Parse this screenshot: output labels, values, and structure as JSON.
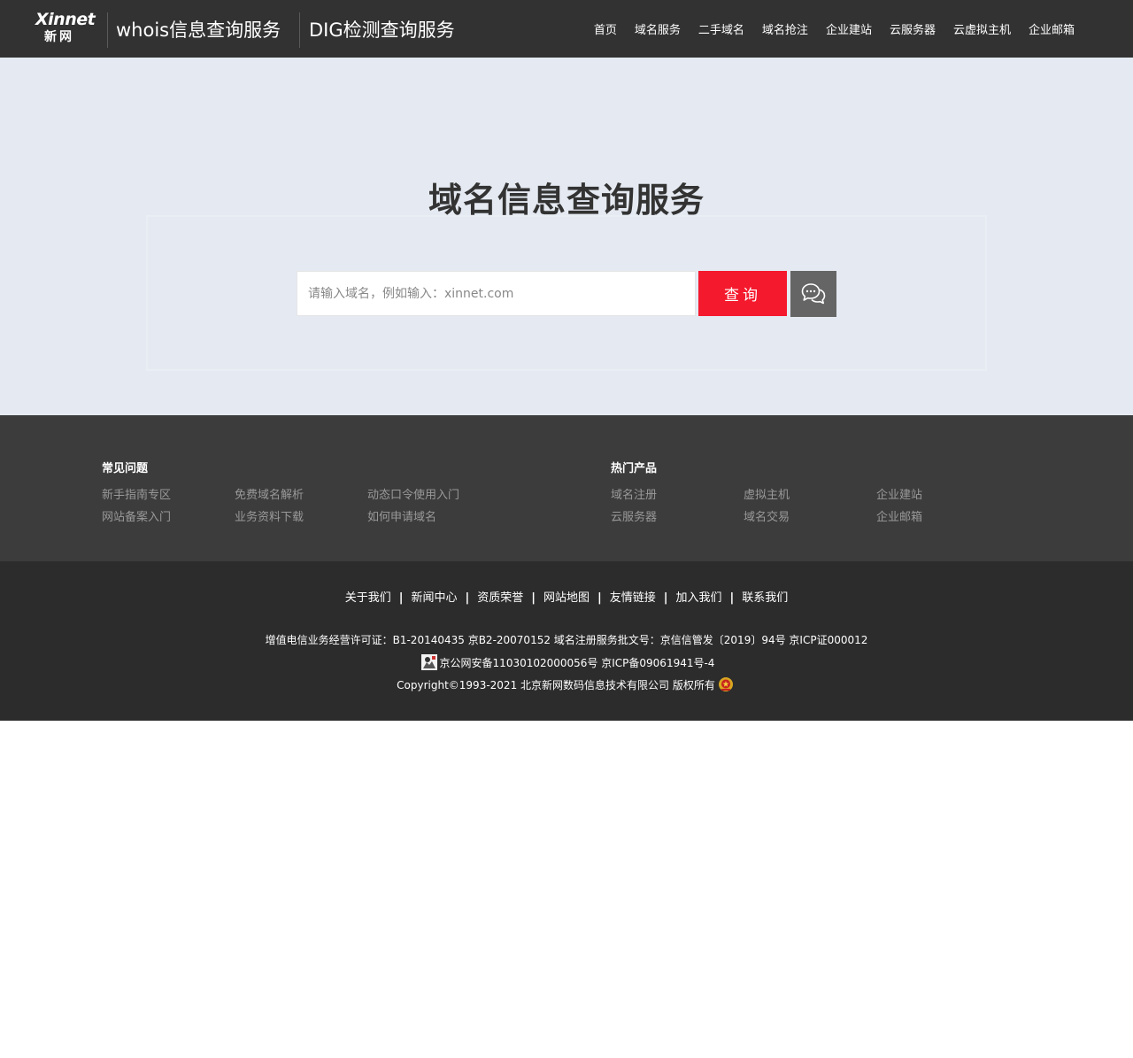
{
  "header": {
    "logo": {
      "line1": "Xinnet",
      "line2": "新网"
    },
    "service_links": [
      "whois信息查询服务",
      "DIG检测查询服务"
    ],
    "nav": [
      "首页",
      "域名服务",
      "二手域名",
      "域名抢注",
      "企业建站",
      "云服务器",
      "云虚拟主机",
      "企业邮箱"
    ]
  },
  "hero": {
    "title": "域名信息查询服务",
    "search": {
      "placeholder": "请输入域名，例如输入：xinnet.com",
      "value": "",
      "button_label": "查询"
    }
  },
  "links": {
    "faq": {
      "title": "常见问题",
      "items": [
        "新手指南专区",
        "免费域名解析",
        "动态口令使用入门",
        "网站备案入门",
        "业务资料下载",
        "如何申请域名"
      ]
    },
    "hot": {
      "title": "热门产品",
      "items": [
        "域名注册",
        "虚拟主机",
        "企业建站",
        "云服务器",
        "域名交易",
        "企业邮箱"
      ]
    }
  },
  "footer": {
    "nav": [
      "关于我们",
      "新闻中心",
      "资质荣誉",
      "网站地图",
      "友情链接",
      "加入我们",
      "联系我们"
    ],
    "license_line": "增值电信业务经营许可证：B1-20140435 京B2-20070152 域名注册服务批文号：京信信管发〔2019〕94号 京ICP证000012",
    "record_line": "京公网安备11030102000056号 京ICP备09061941号-4",
    "copyright": "Copyright©1993-2021 北京新网数码信息技术有限公司 版权所有"
  },
  "colors": {
    "header_bg": "#323232",
    "hero_bg": "#e5eaf2",
    "search_button": "#f5192d",
    "chat_button": "#656565",
    "links_bg": "#3c3c3c",
    "footer_bg": "#2c2c2c"
  }
}
